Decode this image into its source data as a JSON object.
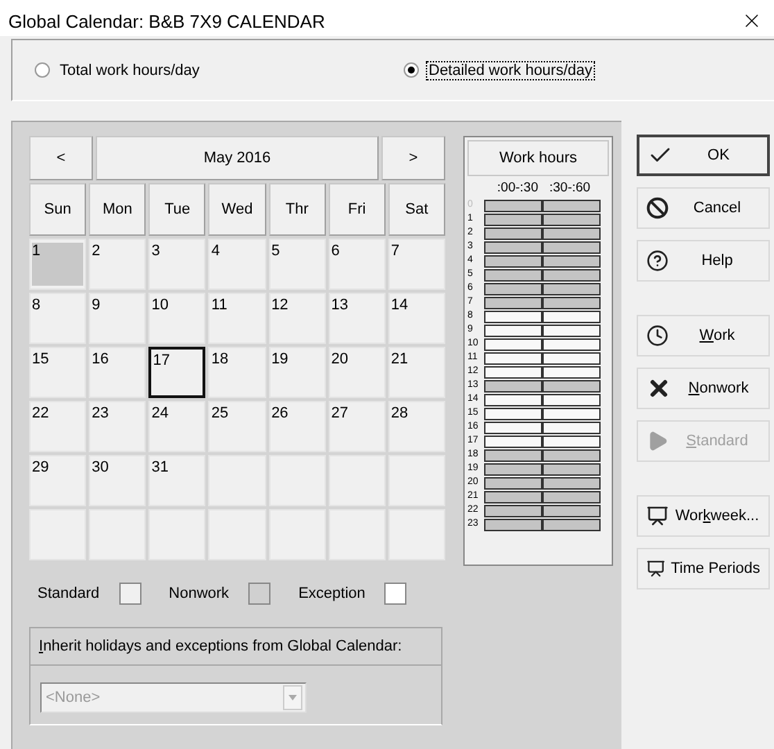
{
  "window": {
    "title": "Global Calendar: B&B 7X9 CALENDAR"
  },
  "mode_options": [
    {
      "label": "Total work hours/day",
      "selected": false,
      "focused": false
    },
    {
      "label": "Detailed work hours/day",
      "selected": true,
      "focused": true
    }
  ],
  "calendar": {
    "prev": "<",
    "month": "May 2016",
    "next": ">",
    "weekdays": [
      "Sun",
      "Mon",
      "Tue",
      "Wed",
      "Thr",
      "Fri",
      "Sat"
    ],
    "weeks": [
      [
        {
          "day": "1",
          "selected": false,
          "nonwork": true
        },
        {
          "day": "2",
          "selected": false,
          "nonwork": false
        },
        {
          "day": "3",
          "selected": false,
          "nonwork": false
        },
        {
          "day": "4",
          "selected": false,
          "nonwork": false
        },
        {
          "day": "5",
          "selected": false,
          "nonwork": false
        },
        {
          "day": "6",
          "selected": false,
          "nonwork": false
        },
        {
          "day": "7",
          "selected": false,
          "nonwork": false
        }
      ],
      [
        {
          "day": "8",
          "selected": false,
          "nonwork": false
        },
        {
          "day": "9",
          "selected": false,
          "nonwork": false
        },
        {
          "day": "10",
          "selected": false,
          "nonwork": false
        },
        {
          "day": "11",
          "selected": false,
          "nonwork": false
        },
        {
          "day": "12",
          "selected": false,
          "nonwork": false
        },
        {
          "day": "13",
          "selected": false,
          "nonwork": false
        },
        {
          "day": "14",
          "selected": false,
          "nonwork": false
        }
      ],
      [
        {
          "day": "15",
          "selected": false,
          "nonwork": false
        },
        {
          "day": "16",
          "selected": false,
          "nonwork": false
        },
        {
          "day": "17",
          "selected": true,
          "nonwork": false
        },
        {
          "day": "18",
          "selected": false,
          "nonwork": false
        },
        {
          "day": "19",
          "selected": false,
          "nonwork": false
        },
        {
          "day": "20",
          "selected": false,
          "nonwork": false
        },
        {
          "day": "21",
          "selected": false,
          "nonwork": false
        }
      ],
      [
        {
          "day": "22",
          "selected": false,
          "nonwork": false
        },
        {
          "day": "23",
          "selected": false,
          "nonwork": false
        },
        {
          "day": "24",
          "selected": false,
          "nonwork": false
        },
        {
          "day": "25",
          "selected": false,
          "nonwork": false
        },
        {
          "day": "26",
          "selected": false,
          "nonwork": false
        },
        {
          "day": "27",
          "selected": false,
          "nonwork": false
        },
        {
          "day": "28",
          "selected": false,
          "nonwork": false
        }
      ],
      [
        {
          "day": "29",
          "selected": false,
          "nonwork": false
        },
        {
          "day": "30",
          "selected": false,
          "nonwork": false
        },
        {
          "day": "31",
          "selected": false,
          "nonwork": false
        }
      ]
    ]
  },
  "work_hours": {
    "title": "Work hours",
    "columns": [
      ":00-:30",
      ":30-:60"
    ],
    "hours": [
      {
        "label": "0",
        "first_half_work": false,
        "second_half_work": false
      },
      {
        "label": "1",
        "first_half_work": false,
        "second_half_work": false
      },
      {
        "label": "2",
        "first_half_work": false,
        "second_half_work": false
      },
      {
        "label": "3",
        "first_half_work": false,
        "second_half_work": false
      },
      {
        "label": "4",
        "first_half_work": false,
        "second_half_work": false
      },
      {
        "label": "5",
        "first_half_work": false,
        "second_half_work": false
      },
      {
        "label": "6",
        "first_half_work": false,
        "second_half_work": false
      },
      {
        "label": "7",
        "first_half_work": false,
        "second_half_work": false
      },
      {
        "label": "8",
        "first_half_work": true,
        "second_half_work": true
      },
      {
        "label": "9",
        "first_half_work": true,
        "second_half_work": true
      },
      {
        "label": "10",
        "first_half_work": true,
        "second_half_work": true
      },
      {
        "label": "11",
        "first_half_work": true,
        "second_half_work": true
      },
      {
        "label": "12",
        "first_half_work": true,
        "second_half_work": true
      },
      {
        "label": "13",
        "first_half_work": false,
        "second_half_work": false
      },
      {
        "label": "14",
        "first_half_work": true,
        "second_half_work": true
      },
      {
        "label": "15",
        "first_half_work": true,
        "second_half_work": true
      },
      {
        "label": "16",
        "first_half_work": true,
        "second_half_work": true
      },
      {
        "label": "17",
        "first_half_work": true,
        "second_half_work": true
      },
      {
        "label": "18",
        "first_half_work": false,
        "second_half_work": false
      },
      {
        "label": "19",
        "first_half_work": false,
        "second_half_work": false
      },
      {
        "label": "20",
        "first_half_work": false,
        "second_half_work": false
      },
      {
        "label": "21",
        "first_half_work": false,
        "second_half_work": false
      },
      {
        "label": "22",
        "first_half_work": false,
        "second_half_work": false
      },
      {
        "label": "23",
        "first_half_work": false,
        "second_half_work": false
      }
    ]
  },
  "legend": [
    {
      "label": "Standard",
      "color": "#f0f0f0"
    },
    {
      "label": "Nonwork",
      "color": "#d0d0d0"
    },
    {
      "label": "Exception",
      "color": "#ffffff"
    }
  ],
  "inherit": {
    "label": "Inherit holidays and exceptions from Global Calendar:",
    "value": "<None>",
    "disabled": true
  },
  "button_groups": [
    [
      {
        "label": "OK",
        "default": true,
        "disabled": false
      },
      {
        "label": "Cancel",
        "default": false,
        "disabled": false
      },
      {
        "label": "Help",
        "default": false,
        "disabled": false
      }
    ],
    [
      {
        "label": "Work",
        "default": false,
        "disabled": false
      },
      {
        "label": "Nonwork",
        "default": false,
        "disabled": false
      },
      {
        "label": "Standard",
        "default": false,
        "disabled": true
      }
    ],
    [
      {
        "label": "Workweek...",
        "default": false,
        "disabled": false
      },
      {
        "label": "Time Periods",
        "default": false,
        "disabled": false
      }
    ]
  ]
}
